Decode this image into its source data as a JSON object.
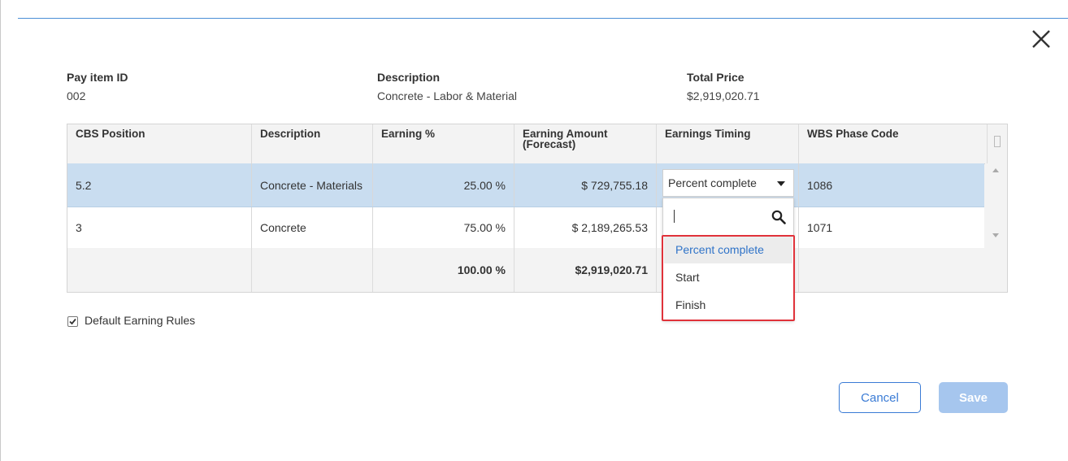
{
  "summary": {
    "pay_item_id_label": "Pay item ID",
    "pay_item_id": "002",
    "description_label": "Description",
    "description": "Concrete - Labor & Material",
    "total_price_label": "Total Price",
    "total_price": "$2,919,020.71"
  },
  "table": {
    "columns": [
      "CBS Position",
      "Description",
      "Earning %",
      "Earning Amount (Forecast)",
      "Earnings Timing",
      "WBS Phase Code"
    ],
    "rows": [
      {
        "cbs": "5.2",
        "description": "Concrete - Materials",
        "earning_pct": "25.00 %",
        "earning_amount": "$ 729,755.18",
        "timing": "Percent complete",
        "wbs": "1086"
      },
      {
        "cbs": "3",
        "description": "Concrete",
        "earning_pct": "75.00 %",
        "earning_amount": "$ 2,189,265.53",
        "timing": "",
        "wbs": "1071"
      }
    ],
    "totals": {
      "earning_pct": "100.00 %",
      "earning_amount": "$2,919,020.71"
    }
  },
  "dropdown": {
    "search_value": "",
    "options": [
      "Percent complete",
      "Start",
      "Finish"
    ],
    "selected": "Percent complete"
  },
  "checkbox": {
    "label": "Default Earning Rules",
    "checked": true
  },
  "buttons": {
    "cancel": "Cancel",
    "save": "Save"
  },
  "colors": {
    "accent": "#3a7bd5",
    "selected_row": "#c9ddf0",
    "total_pct": "#2e8b2e",
    "highlight": "#e0323a",
    "save_disabled": "#a6c6ee"
  }
}
